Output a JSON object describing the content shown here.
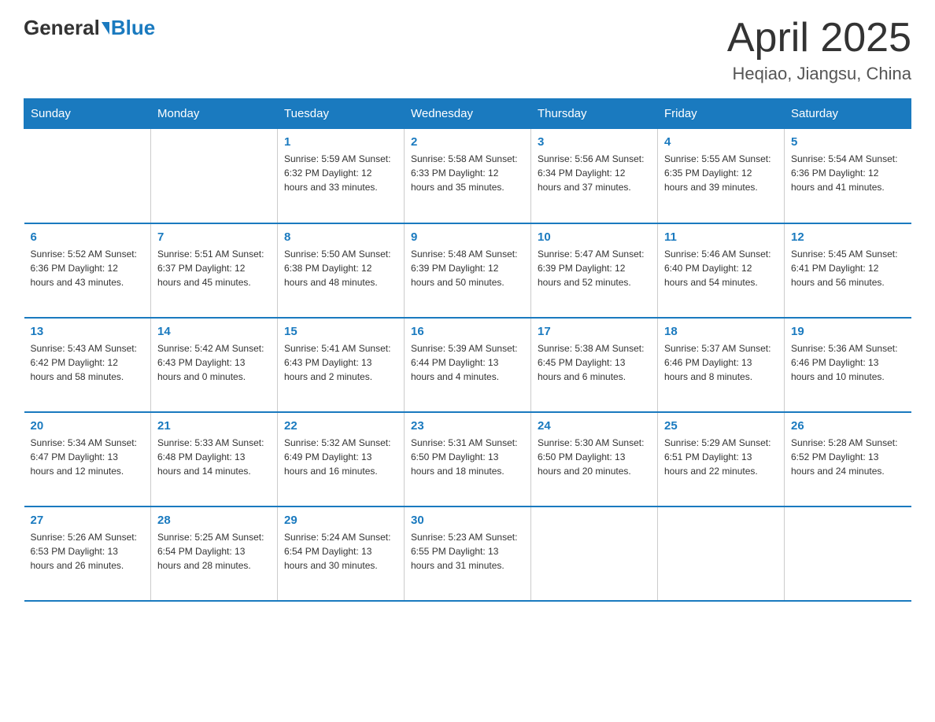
{
  "header": {
    "logo_general": "General",
    "logo_blue": "Blue",
    "title": "April 2025",
    "location": "Heqiao, Jiangsu, China"
  },
  "weekdays": [
    "Sunday",
    "Monday",
    "Tuesday",
    "Wednesday",
    "Thursday",
    "Friday",
    "Saturday"
  ],
  "weeks": [
    [
      {
        "day": "",
        "info": ""
      },
      {
        "day": "",
        "info": ""
      },
      {
        "day": "1",
        "info": "Sunrise: 5:59 AM\nSunset: 6:32 PM\nDaylight: 12 hours\nand 33 minutes."
      },
      {
        "day": "2",
        "info": "Sunrise: 5:58 AM\nSunset: 6:33 PM\nDaylight: 12 hours\nand 35 minutes."
      },
      {
        "day": "3",
        "info": "Sunrise: 5:56 AM\nSunset: 6:34 PM\nDaylight: 12 hours\nand 37 minutes."
      },
      {
        "day": "4",
        "info": "Sunrise: 5:55 AM\nSunset: 6:35 PM\nDaylight: 12 hours\nand 39 minutes."
      },
      {
        "day": "5",
        "info": "Sunrise: 5:54 AM\nSunset: 6:36 PM\nDaylight: 12 hours\nand 41 minutes."
      }
    ],
    [
      {
        "day": "6",
        "info": "Sunrise: 5:52 AM\nSunset: 6:36 PM\nDaylight: 12 hours\nand 43 minutes."
      },
      {
        "day": "7",
        "info": "Sunrise: 5:51 AM\nSunset: 6:37 PM\nDaylight: 12 hours\nand 45 minutes."
      },
      {
        "day": "8",
        "info": "Sunrise: 5:50 AM\nSunset: 6:38 PM\nDaylight: 12 hours\nand 48 minutes."
      },
      {
        "day": "9",
        "info": "Sunrise: 5:48 AM\nSunset: 6:39 PM\nDaylight: 12 hours\nand 50 minutes."
      },
      {
        "day": "10",
        "info": "Sunrise: 5:47 AM\nSunset: 6:39 PM\nDaylight: 12 hours\nand 52 minutes."
      },
      {
        "day": "11",
        "info": "Sunrise: 5:46 AM\nSunset: 6:40 PM\nDaylight: 12 hours\nand 54 minutes."
      },
      {
        "day": "12",
        "info": "Sunrise: 5:45 AM\nSunset: 6:41 PM\nDaylight: 12 hours\nand 56 minutes."
      }
    ],
    [
      {
        "day": "13",
        "info": "Sunrise: 5:43 AM\nSunset: 6:42 PM\nDaylight: 12 hours\nand 58 minutes."
      },
      {
        "day": "14",
        "info": "Sunrise: 5:42 AM\nSunset: 6:43 PM\nDaylight: 13 hours\nand 0 minutes."
      },
      {
        "day": "15",
        "info": "Sunrise: 5:41 AM\nSunset: 6:43 PM\nDaylight: 13 hours\nand 2 minutes."
      },
      {
        "day": "16",
        "info": "Sunrise: 5:39 AM\nSunset: 6:44 PM\nDaylight: 13 hours\nand 4 minutes."
      },
      {
        "day": "17",
        "info": "Sunrise: 5:38 AM\nSunset: 6:45 PM\nDaylight: 13 hours\nand 6 minutes."
      },
      {
        "day": "18",
        "info": "Sunrise: 5:37 AM\nSunset: 6:46 PM\nDaylight: 13 hours\nand 8 minutes."
      },
      {
        "day": "19",
        "info": "Sunrise: 5:36 AM\nSunset: 6:46 PM\nDaylight: 13 hours\nand 10 minutes."
      }
    ],
    [
      {
        "day": "20",
        "info": "Sunrise: 5:34 AM\nSunset: 6:47 PM\nDaylight: 13 hours\nand 12 minutes."
      },
      {
        "day": "21",
        "info": "Sunrise: 5:33 AM\nSunset: 6:48 PM\nDaylight: 13 hours\nand 14 minutes."
      },
      {
        "day": "22",
        "info": "Sunrise: 5:32 AM\nSunset: 6:49 PM\nDaylight: 13 hours\nand 16 minutes."
      },
      {
        "day": "23",
        "info": "Sunrise: 5:31 AM\nSunset: 6:50 PM\nDaylight: 13 hours\nand 18 minutes."
      },
      {
        "day": "24",
        "info": "Sunrise: 5:30 AM\nSunset: 6:50 PM\nDaylight: 13 hours\nand 20 minutes."
      },
      {
        "day": "25",
        "info": "Sunrise: 5:29 AM\nSunset: 6:51 PM\nDaylight: 13 hours\nand 22 minutes."
      },
      {
        "day": "26",
        "info": "Sunrise: 5:28 AM\nSunset: 6:52 PM\nDaylight: 13 hours\nand 24 minutes."
      }
    ],
    [
      {
        "day": "27",
        "info": "Sunrise: 5:26 AM\nSunset: 6:53 PM\nDaylight: 13 hours\nand 26 minutes."
      },
      {
        "day": "28",
        "info": "Sunrise: 5:25 AM\nSunset: 6:54 PM\nDaylight: 13 hours\nand 28 minutes."
      },
      {
        "day": "29",
        "info": "Sunrise: 5:24 AM\nSunset: 6:54 PM\nDaylight: 13 hours\nand 30 minutes."
      },
      {
        "day": "30",
        "info": "Sunrise: 5:23 AM\nSunset: 6:55 PM\nDaylight: 13 hours\nand 31 minutes."
      },
      {
        "day": "",
        "info": ""
      },
      {
        "day": "",
        "info": ""
      },
      {
        "day": "",
        "info": ""
      }
    ]
  ]
}
